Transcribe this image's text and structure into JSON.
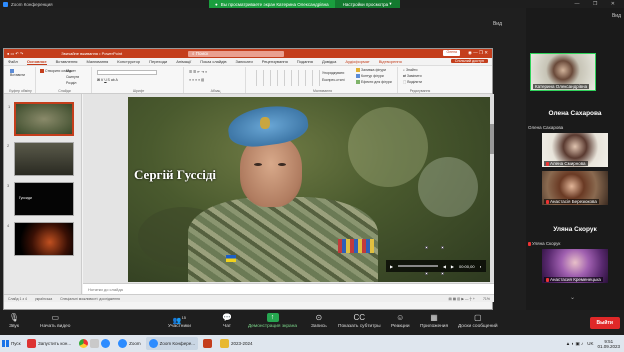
{
  "zoom": {
    "window_title": "Zoom Конференция",
    "share_banner": "Вы просматриваете экран Катерина Олександрівна",
    "view_options": "Настройки просмотра",
    "view_button": "Вид",
    "exit_fullscreen": "Вид"
  },
  "powerpoint": {
    "file_title": "Звичайне вживання • PowerPoint",
    "search_placeholder": "Поиск",
    "title_button": "Олена",
    "tabs": [
      "Файл",
      "Основное",
      "Вставлення",
      "Малювання",
      "Конструктор",
      "Переходи",
      "Анімації",
      "Показ слайдів",
      "Записати",
      "Рецензування",
      "Подання",
      "Довідка",
      "Аудіоформат",
      "Відтворення"
    ],
    "access_button": "Спільний доступ",
    "ribbon": {
      "clipboard_label": "Буфер обміну",
      "slides_label": "Слайди",
      "font_label": "Шрифт",
      "paragraph_label": "Абзац",
      "drawing_label": "Малювання",
      "editing_label": "Редагування",
      "paste": "Вставити",
      "new_slide": "Створити слайд",
      "layout": "Макет",
      "reset": "Скинути",
      "section": "Розділ",
      "arrange": "Упорядкувати",
      "quick_styles": "Експрес-стилі",
      "shape_fill": "Заливка фігури",
      "shape_outline": "Контур фігури",
      "shape_effects": "Ефекти для фігури",
      "find": "Знайти",
      "replace": "Замінити",
      "select": "Виділити"
    },
    "slides": [
      {
        "num": "1",
        "selected": true
      },
      {
        "num": "2",
        "selected": false
      },
      {
        "num": "3",
        "selected": false,
        "caption": "Гуссиди"
      },
      {
        "num": "4",
        "selected": false
      }
    ],
    "slide_title": "Сергій Гуссіді",
    "player_time": "00:00,00",
    "notes_placeholder": "Нотатки до слайда",
    "status_left": "Слайд 1 з 4",
    "status_lang": "українська",
    "status_access": "Спеціальні можливості: дослідження",
    "status_zoom": "71%"
  },
  "participants": {
    "featured": {
      "name": "Катерина Олександрівна"
    },
    "tiles": [
      {
        "big": "Олена Сахарова",
        "small": "Олена Сахарова"
      },
      {
        "label": "Алена Смирнова"
      },
      {
        "label": "Анастасія Березюкова"
      },
      {
        "big": "Уляна Скорук",
        "small": "Уляна Скорук"
      },
      {
        "label": "Анастасия Кременецька"
      }
    ]
  },
  "toolbar": {
    "mute": "Звук",
    "video": "Начать видео",
    "participants": "Участники",
    "participants_count": "15",
    "chat": "Чат",
    "share": "Демонстрация экрана",
    "record": "Запись",
    "captions": "Показать субтитры",
    "reactions": "Реакции",
    "apps": "Приложения",
    "whiteboards": "Доски сообщений",
    "exit": "Выйти"
  },
  "taskbar": {
    "start": "Пуск",
    "apps": [
      "Запустить кон...",
      "Zoom",
      "Zoom Конфере...",
      "2023-2024"
    ],
    "lang": "UK",
    "time": "9:51",
    "date": "01.09.2023"
  },
  "colors": {
    "ppt_accent": "#c43e1c",
    "zoom_green": "#26a650",
    "exit_red": "#e02828",
    "zoom_blue": "#2d8cff"
  }
}
